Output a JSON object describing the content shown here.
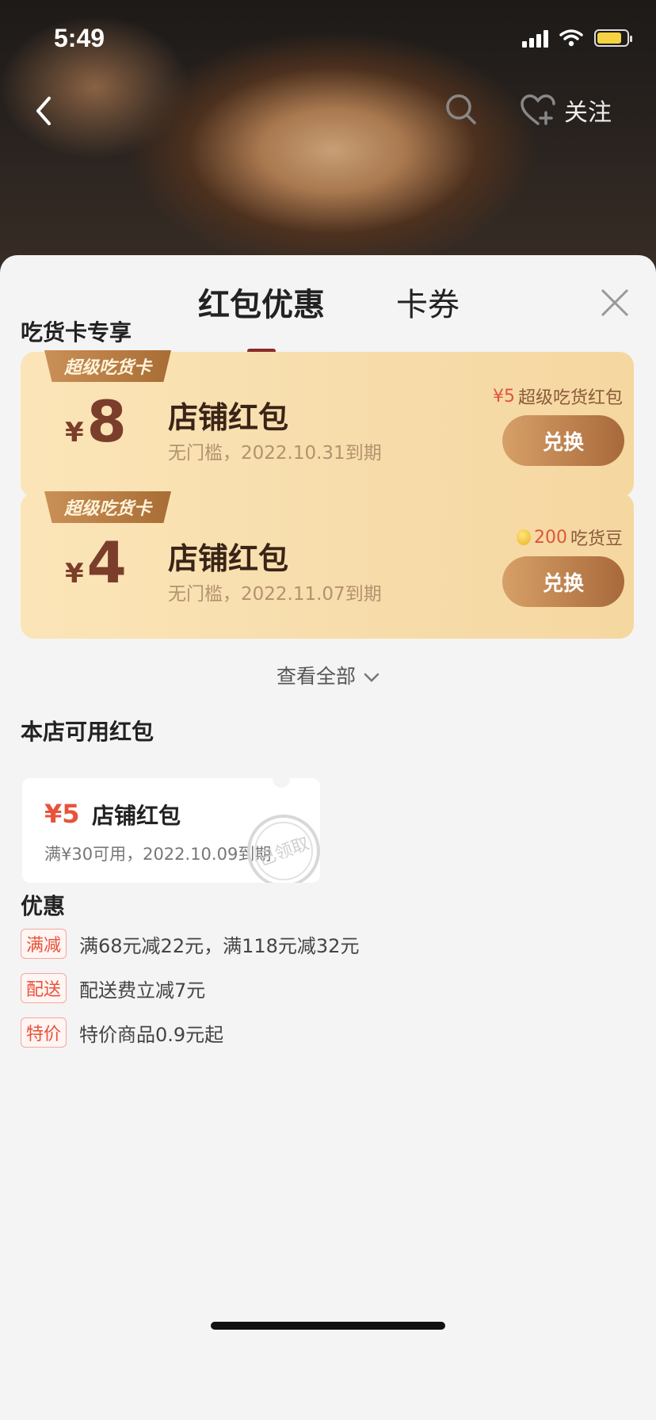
{
  "status": {
    "time": "5:49"
  },
  "nav": {
    "follow_label": "关注"
  },
  "tabs": [
    {
      "label": "红包优惠"
    },
    {
      "label": "卡券"
    }
  ],
  "vip_section": {
    "title": "吃货卡专享",
    "cards": [
      {
        "tag": "超级吃货卡",
        "currency": "¥",
        "amount": "8",
        "name": "店铺红包",
        "desc": "无门槛，2022.10.31到期",
        "cost_value": "¥5",
        "cost_unit": "超级吃货红包",
        "button": "兑换"
      },
      {
        "tag": "超级吃货卡",
        "currency": "¥",
        "amount": "4",
        "name": "店铺红包",
        "desc": "无门槛，2022.11.07到期",
        "cost_value": "200",
        "cost_unit": "吃货豆",
        "button": "兑换"
      }
    ],
    "view_all": "查看全部"
  },
  "shop_section": {
    "title": "本店可用红包",
    "coupon": {
      "amount": "¥5",
      "name": "店铺红包",
      "desc": "满¥30可用，2022.10.09到期",
      "stamp": "已领取"
    }
  },
  "promo_section": {
    "title": "优惠",
    "items": [
      {
        "tag": "满减",
        "text": "满68元减22元，满118元减32元"
      },
      {
        "tag": "配送",
        "text": "配送费立减7元"
      },
      {
        "tag": "特价",
        "text": "特价商品0.9元起"
      }
    ]
  },
  "colors": {
    "accent_red": "#e8523a",
    "tab_underline": "#8b2a2a",
    "vip_brown": "#7a3e2a"
  }
}
